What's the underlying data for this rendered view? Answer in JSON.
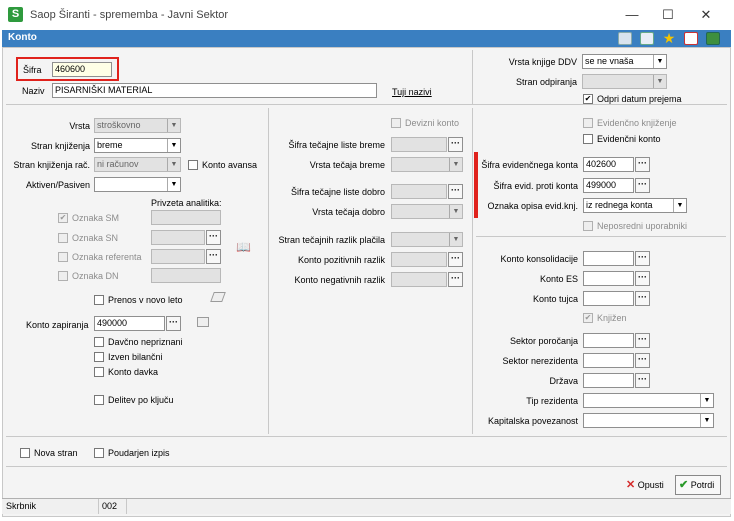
{
  "window": {
    "title": "Saop Širanti - sprememba - Javni Sektor",
    "app_icon": "S",
    "minimize": "—",
    "maximize": "☐",
    "close": "✕"
  },
  "header": {
    "title": "Konto",
    "icons": [
      "edit-icon",
      "calendar-icon",
      "star-icon",
      "delete-icon",
      "export-icon"
    ]
  },
  "top": {
    "sifra_label": "Šifra",
    "sifra_value": "460600",
    "naziv_label": "Naziv",
    "naziv_value": "PISARNIŠKI MATERIAL",
    "tuji_nazivi": "Tuji nazivi"
  },
  "ddv": {
    "vrsta_label": "Vrsta knjige DDV",
    "vrsta_value": "se ne vnaša",
    "stran_label": "Stran odpiranja",
    "stran_value": "",
    "odpri_label": "Odpri datum prejema"
  },
  "left": {
    "vrsta_label": "Vrsta",
    "vrsta_value": "stroškovno",
    "stran_knj_label": "Stran knjiženja",
    "stran_knj_value": "breme",
    "stran_knj_rac_label": "Stran knjiženja rač.",
    "stran_knj_rac_value": "ni računov",
    "konto_avansa": "Konto avansa",
    "aktiven_label": "Aktiven/Pasiven",
    "aktiven_value": "",
    "privzeta": "Privzeta analitika:",
    "oznaka_sm": "Oznaka SM",
    "oznaka_sn": "Oznaka SN",
    "oznaka_ref": "Oznaka referenta",
    "oznaka_dn": "Oznaka DN",
    "prenos": "Prenos v novo leto",
    "konto_zap_label": "Konto zapiranja",
    "konto_zap_value": "490000",
    "davcno": "Davčno nepriznani",
    "izven": "Izven bilančni",
    "konto_davka": "Konto davka",
    "delitev": "Delitev po ključu"
  },
  "mid": {
    "devizni": "Devizni konto",
    "sifra_breme": "Šifra tečajne liste breme",
    "vrsta_breme": "Vrsta tečaja breme",
    "sifra_dobro": "Šifra tečajne liste dobro",
    "vrsta_dobro": "Vrsta tečaja dobro",
    "stran_razlik": "Stran tečajnih razlik plačila",
    "konto_poz": "Konto pozitivnih razlik",
    "konto_neg": "Konto negativnih razlik"
  },
  "right": {
    "evid_knj": "Evidenčno knjiženje",
    "evid_konto": "Evidenčni konto",
    "sifra_evid_label": "Šifra evidenčnega konta",
    "sifra_evid_value": "402600",
    "sifra_proti_label": "Šifra evid. proti konta",
    "sifra_proti_value": "499000",
    "oznaka_opisa_label": "Oznaka opisa evid.knj.",
    "oznaka_opisa_value": "iz rednega konta",
    "neposredni": "Neposredni uporabniki",
    "konto_kons": "Konto konsolidacije",
    "konto_es": "Konto ES",
    "konto_tujca": "Konto tujca",
    "knjizen": "Knjižen",
    "sektor_por": "Sektor poročanja",
    "sektor_ner": "Sektor nerezidenta",
    "drzava": "Država",
    "tip_rez": "Tip rezidenta",
    "kap_pov": "Kapitalska povezanost"
  },
  "footer": {
    "nova_stran": "Nova stran",
    "poudarjen": "Poudarjen izpis",
    "opusti": "Opusti",
    "potrdi": "Potrdi"
  },
  "status": {
    "user": "Skrbnik",
    "code": "002"
  },
  "colors": {
    "header": "#3a7fc1",
    "highlight": "#e0221c",
    "app_icon": "#2e9a3d"
  }
}
